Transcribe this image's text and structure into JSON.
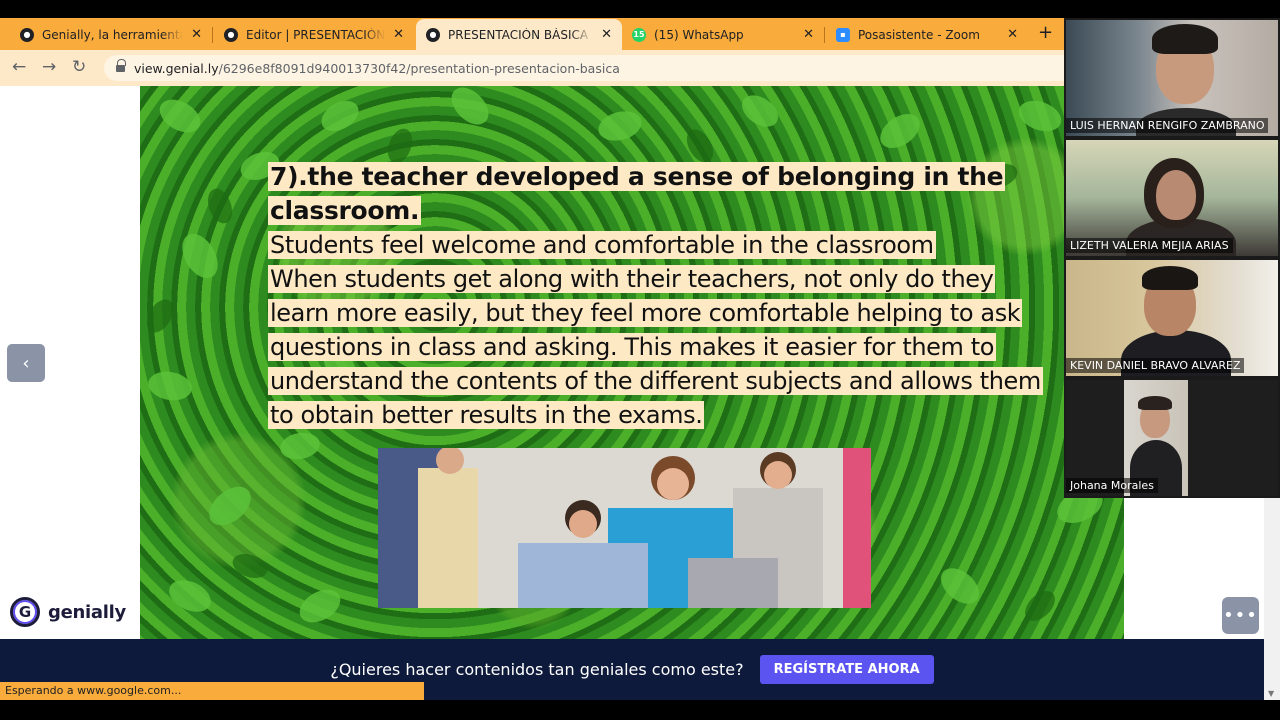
{
  "browser": {
    "tabs": [
      {
        "title": "Genially, la herramienta para crear contenidos",
        "favicon": "chrome-icon"
      },
      {
        "title": "Editor | PRESENTACIÓN BÁSICA",
        "favicon": "chrome-icon"
      },
      {
        "title": "PRESENTACIÓN BÁSICA por Genially",
        "favicon": "chrome-icon",
        "active": true
      },
      {
        "title": "(15) WhatsApp",
        "favicon": "whatsapp-icon",
        "badge": "15"
      },
      {
        "title": "Posasistente - Zoom",
        "favicon": "zoom-icon"
      }
    ],
    "close_glyph": "✕",
    "new_tab_glyph": "+",
    "url_host": "view.genial.ly",
    "url_path": "/6296e8f8091d940013730f42/presentation-presentacion-basica",
    "status_text": "Esperando a www.google.com..."
  },
  "slide": {
    "heading": "7).the teacher developed a sense of belonging in the classroom.",
    "body_lines": [
      "Students feel welcome and comfortable in the classroom",
      "When students get along with their teachers, not only do they learn more easily, but they feel more comfortable helping to ask questions in class and asking. This makes it easier for them to understand the contents of the different subjects and allows them to obtain better results in the exams."
    ]
  },
  "controls": {
    "prev_glyph": "‹",
    "more_glyph": "•••"
  },
  "brand": {
    "logo_letter": "G",
    "name": "genially"
  },
  "banner": {
    "message": "¿Quieres hacer contenidos tan geniales como este?",
    "cta": "REGÍSTRATE AHORA"
  },
  "zoom": {
    "participants": [
      {
        "name": "LUIS HERNAN RENGIFO ZAMBRANO"
      },
      {
        "name": "LIZETH VALERIA MEJIA ARIAS"
      },
      {
        "name": "KEVIN DANIEL BRAVO ALVAREZ"
      },
      {
        "name": "Johana Morales"
      }
    ]
  },
  "colors": {
    "tab_strip": "#f9ab3c",
    "toolbar": "#fde9c8",
    "banner": "#0e1a3c",
    "cta": "#5b54f0",
    "text_highlight": "#fde9c4"
  }
}
